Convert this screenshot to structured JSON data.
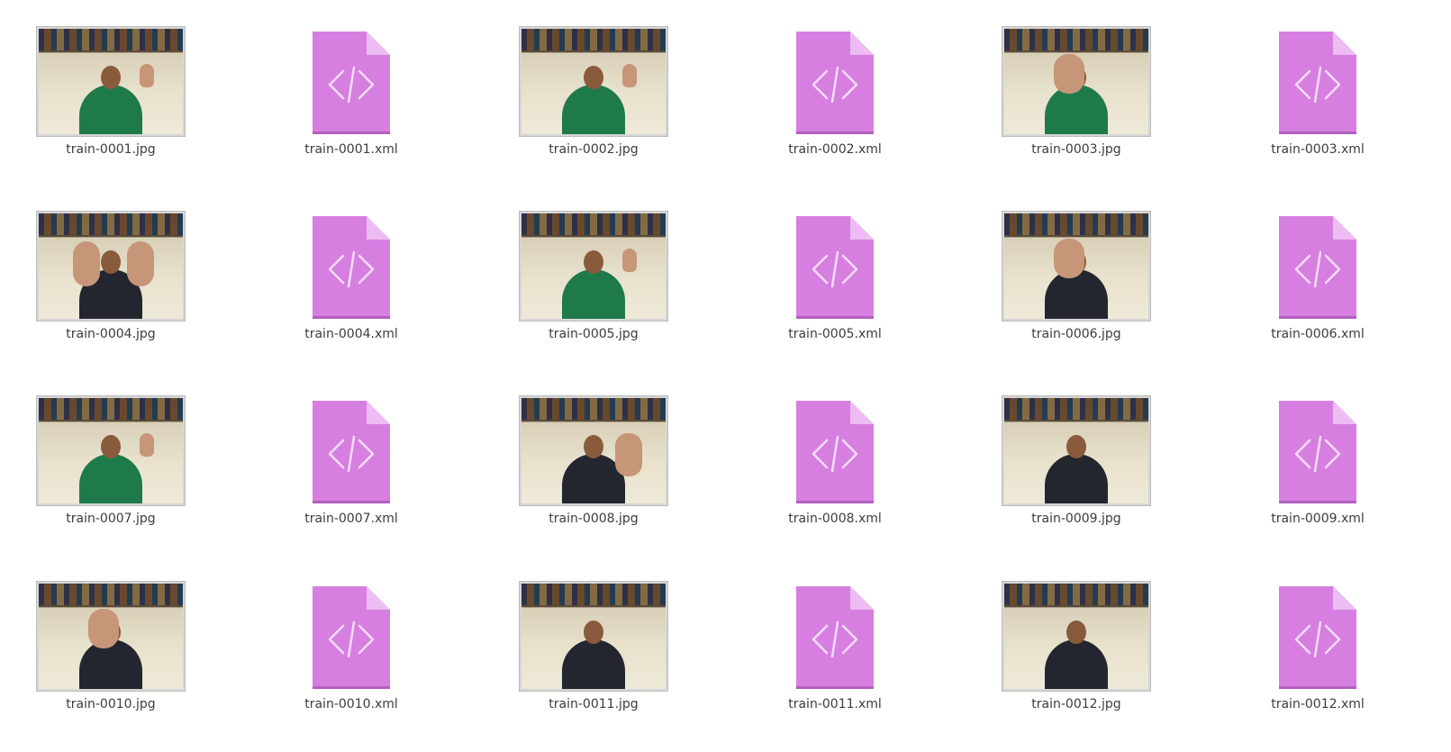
{
  "files": [
    {
      "name": "train-0001.jpg",
      "kind": "image",
      "variant": "green-point"
    },
    {
      "name": "train-0001.xml",
      "kind": "xml"
    },
    {
      "name": "train-0002.jpg",
      "kind": "image",
      "variant": "green-thumb"
    },
    {
      "name": "train-0002.xml",
      "kind": "xml"
    },
    {
      "name": "train-0003.jpg",
      "kind": "image",
      "variant": "green-palm"
    },
    {
      "name": "train-0003.xml",
      "kind": "xml"
    },
    {
      "name": "train-0004.jpg",
      "kind": "image",
      "variant": "dark-hands"
    },
    {
      "name": "train-0004.xml",
      "kind": "xml"
    },
    {
      "name": "train-0005.jpg",
      "kind": "image",
      "variant": "green-sign"
    },
    {
      "name": "train-0005.xml",
      "kind": "xml"
    },
    {
      "name": "train-0006.jpg",
      "kind": "image",
      "variant": "dark-palm"
    },
    {
      "name": "train-0006.xml",
      "kind": "xml"
    },
    {
      "name": "train-0007.jpg",
      "kind": "image",
      "variant": "green-sign"
    },
    {
      "name": "train-0007.xml",
      "kind": "xml"
    },
    {
      "name": "train-0008.jpg",
      "kind": "image",
      "variant": "dark-four"
    },
    {
      "name": "train-0008.xml",
      "kind": "xml"
    },
    {
      "name": "train-0009.jpg",
      "kind": "image",
      "variant": "dark-sit"
    },
    {
      "name": "train-0009.xml",
      "kind": "xml"
    },
    {
      "name": "train-0010.jpg",
      "kind": "image",
      "variant": "dark-palm"
    },
    {
      "name": "train-0010.xml",
      "kind": "xml"
    },
    {
      "name": "train-0011.jpg",
      "kind": "image",
      "variant": "dark-sit"
    },
    {
      "name": "train-0011.xml",
      "kind": "xml"
    },
    {
      "name": "train-0012.jpg",
      "kind": "image",
      "variant": "dark-sit"
    },
    {
      "name": "train-0012.xml",
      "kind": "xml"
    }
  ],
  "colors": {
    "xml_icon_body": "#d67fe0",
    "xml_icon_fold": "#ecbcf2",
    "xml_icon_symbol": "#f4dcf7",
    "label_text": "#3c3c3c"
  },
  "icons": {
    "xml": "code-file-icon",
    "image": "image-thumbnail"
  }
}
